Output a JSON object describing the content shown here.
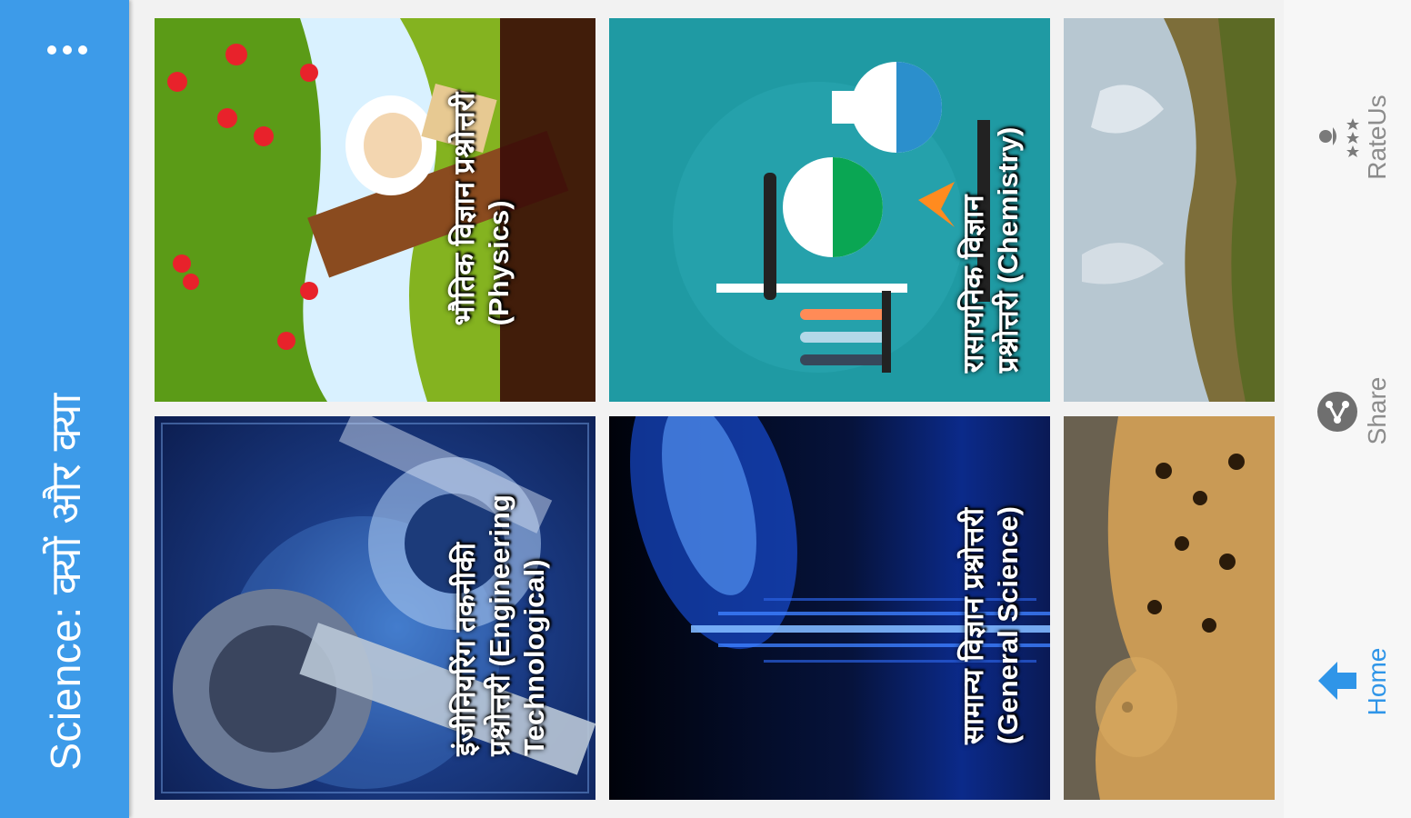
{
  "app_bar": {
    "title": "Science: क्यों और क्या",
    "menu_icon": "overflow-menu-icon",
    "color": "#3d9be9"
  },
  "tiles": [
    {
      "caption_line1": "भौतिक विज्ञान प्रश्नोत्तरी",
      "caption_line2": "(Physics)"
    },
    {
      "caption_line1": "रासायनिक विज्ञान",
      "caption_line2": "प्रश्नोत्तरी (Chemistry)"
    },
    {
      "caption_line1": "",
      "caption_line2": ""
    },
    {
      "caption_line1": "इंजीनियरिंग तकनीकी",
      "caption_line2": "प्रश्नोत्तरी (Engineering",
      "caption_line3": "Technological)"
    },
    {
      "caption_line1": "सामान्य विज्ञान प्रश्नोत्तरी",
      "caption_line2": "(General Science)"
    },
    {
      "caption_line1": "",
      "caption_line2": ""
    }
  ],
  "bottom_nav": {
    "items": [
      {
        "label": "Home",
        "icon": "home-icon",
        "active": true
      },
      {
        "label": "Share",
        "icon": "share-icon",
        "active": false
      },
      {
        "label": "RateUs",
        "icon": "rate-us-icon",
        "active": false
      }
    ],
    "active_color": "#2f95e8",
    "inactive_color": "#8c8c8c"
  }
}
